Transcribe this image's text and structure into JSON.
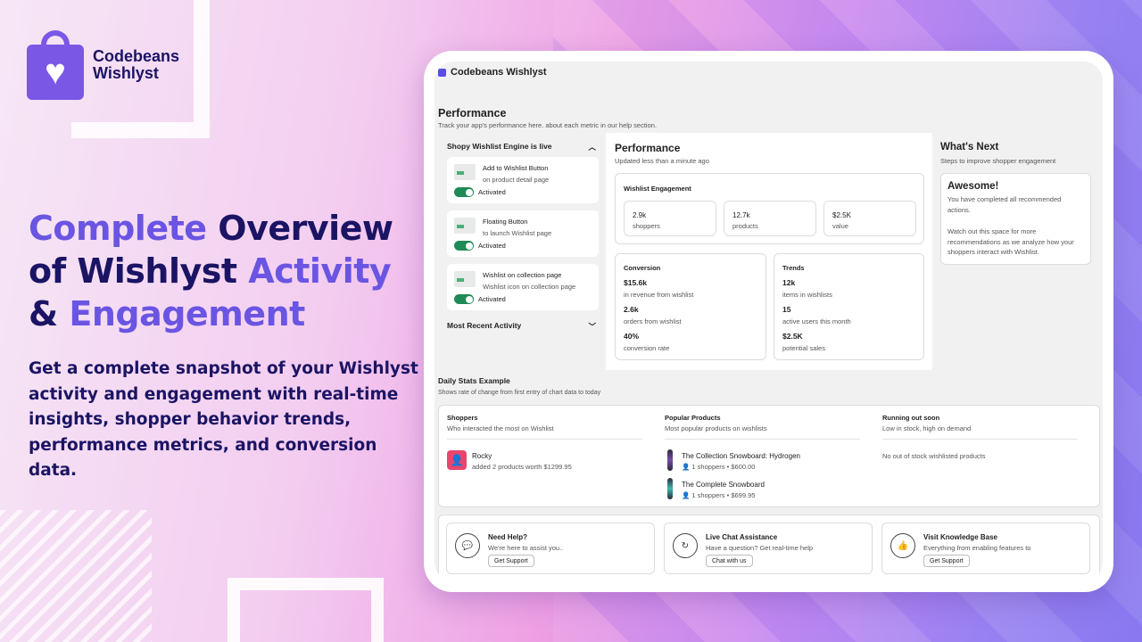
{
  "brand": {
    "line1": "Codebeans",
    "line2": "Wishlyst"
  },
  "headline": {
    "w1": "Complete",
    "w2": "Overview",
    "w3": "of Wishlyst",
    "w4": "Activity",
    "w5": "&",
    "w6": "Engagement"
  },
  "subhead": "Get a complete snapshot of your Wishlyst activity and engagement with real-time insights, shopper behavior trends, performance metrics, and conversion data.",
  "app": {
    "name": "Codebeans Wishlyst",
    "title": "Performance",
    "subtitle": "Track your app's performance here. about each metric in our help section."
  },
  "left": {
    "live_title": "Shopy Wishlist Engine is live",
    "features": [
      {
        "title": "Add to Wishlist Button",
        "desc": "on product detail page",
        "status": "Activated"
      },
      {
        "title": "Floating Button",
        "desc": "to launch Wishlist page",
        "status": "Activated"
      },
      {
        "title": "Wishlist on collection page",
        "desc": "Wishlist icon on collection page",
        "status": "Activated"
      }
    ],
    "recent_title": "Most Recent Activity"
  },
  "mid": {
    "title": "Performance",
    "updated": "Updated less than a minute ago",
    "engagement_title": "Wishlist Engagement",
    "stats": [
      {
        "value": "2.9k",
        "label": "shoppers"
      },
      {
        "value": "12.7k",
        "label": "products"
      },
      {
        "value": "$2.5K",
        "label": "value"
      }
    ],
    "conversion": {
      "title": "Conversion",
      "rows": [
        {
          "value": "$15.6k",
          "label": "in revenue from wishlist"
        },
        {
          "value": "2.6k",
          "label": "orders from wishlist"
        },
        {
          "value": "40%",
          "label": "conversion rate"
        }
      ]
    },
    "trends": {
      "title": "Trends",
      "rows": [
        {
          "value": "12k",
          "label": "items in wishlists"
        },
        {
          "value": "15",
          "label": "active users this month"
        },
        {
          "value": "$2.5K",
          "label": "potential sales"
        }
      ]
    }
  },
  "right": {
    "title": "What's Next",
    "subtitle": "Steps to improve shopper engagement",
    "card_title": "Awesome!",
    "p1": "You have completed all recommended actions.",
    "p2": "Watch out this space for more recommendations as we analyze how your shoppers interact with Wishlist."
  },
  "daily": {
    "title": "Daily Stats Example",
    "subtitle": "Shows rate of change from first entry of chart data to today",
    "shoppers": {
      "title": "Shoppers",
      "desc": "Who interacted the most on Wishlist",
      "name": "Rocky",
      "note": "added 2 products worth $1299.95"
    },
    "popular": {
      "title": "Popular Products",
      "desc": "Most popular products on wishlists",
      "items": [
        {
          "name": "The Collection Snowboard: Hydrogen",
          "meta": "👤 1 shoppers • $600.00"
        },
        {
          "name": "The Complete Snowboard",
          "meta": "👤 1 shoppers • $699.95"
        }
      ]
    },
    "running": {
      "title": "Running out soon",
      "desc": "Low in stock, high on demand",
      "empty": "No out of stock wishlisted products"
    }
  },
  "help": [
    {
      "title": "Need Help?",
      "desc": "We're here to assist you..",
      "button": "Get Support"
    },
    {
      "title": "Live Chat Assistance",
      "desc": "Have a question? Get real-time help",
      "button": "Chat with us"
    },
    {
      "title": "Visit Knowledge Base",
      "desc": "Everything from enabling features to",
      "button": "Get Support"
    }
  ]
}
